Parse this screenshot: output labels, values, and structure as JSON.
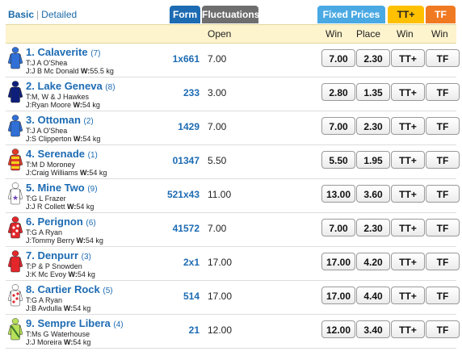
{
  "view_toggle": {
    "basic": "Basic",
    "separator": "|",
    "detailed": "Detailed"
  },
  "tabs": {
    "form": "Form",
    "fluctuations": "Fluctuations",
    "fixed_prices": "Fixed Prices",
    "tt_plus": "TT+",
    "tf": "TF"
  },
  "headers": {
    "open": "Open",
    "win": "Win",
    "place": "Place",
    "tt_win": "Win",
    "tf_win": "Win"
  },
  "colors": {
    "link_blue": "#1d6bb3",
    "header_bg": "#fdf3cc",
    "fixed_prices": "#4aa9e3",
    "tt_plus": "#ffc000",
    "tf": "#f07a22"
  },
  "runners": [
    {
      "name": "1. Calaverite",
      "barrier": "(7)",
      "trainer": "T:J A O'Shea",
      "jockey": "J:J B Mc Donald",
      "weight_label": "W:",
      "weight": "55.5 kg",
      "form": "1x661",
      "open": "7.00",
      "win": "7.00",
      "place": "2.30",
      "tt": "TT+",
      "tf": "TF",
      "silk": "blue"
    },
    {
      "name": "2. Lake Geneva",
      "barrier": "(8)",
      "trainer": "T:M, W & J Hawkes",
      "jockey": "J:Ryan Moore",
      "weight_label": "W:",
      "weight": "54 kg",
      "form": "233",
      "open": "3.00",
      "win": "2.80",
      "place": "1.35",
      "tt": "TT+",
      "tf": "TF",
      "silk": "navy"
    },
    {
      "name": "3. Ottoman",
      "barrier": "(2)",
      "trainer": "T:J A O'Shea",
      "jockey": "J:S Clipperton",
      "weight_label": "W:",
      "weight": "54 kg",
      "form": "1429",
      "open": "7.00",
      "win": "7.00",
      "place": "2.30",
      "tt": "TT+",
      "tf": "TF",
      "silk": "blue"
    },
    {
      "name": "4. Serenade",
      "barrier": "(1)",
      "trainer": "T:M D Moroney",
      "jockey": "J:Craig Williams",
      "weight_label": "W:",
      "weight": "54 kg",
      "form": "01347",
      "open": "5.50",
      "win": "5.50",
      "place": "1.95",
      "tt": "TT+",
      "tf": "TF",
      "silk": "red-yellow"
    },
    {
      "name": "5. Mine Two",
      "barrier": "(9)",
      "trainer": "T:G L Frazer",
      "jockey": "J:J R Collett",
      "weight_label": "W:",
      "weight": "54 kg",
      "form": "521x43",
      "open": "11.00",
      "win": "13.00",
      "place": "3.60",
      "tt": "TT+",
      "tf": "TF",
      "silk": "white-purple"
    },
    {
      "name": "6. Perignon",
      "barrier": "(6)",
      "trainer": "T:G A Ryan",
      "jockey": "J:Tommy Berry",
      "weight_label": "W:",
      "weight": "54 kg",
      "form": "41572",
      "open": "7.00",
      "win": "7.00",
      "place": "2.30",
      "tt": "TT+",
      "tf": "TF",
      "silk": "red-spots"
    },
    {
      "name": "7. Denpurr",
      "barrier": "(3)",
      "trainer": "T:P & P Snowden",
      "jockey": "J:K Mc Evoy",
      "weight_label": "W:",
      "weight": "54 kg",
      "form": "2x1",
      "open": "17.00",
      "win": "17.00",
      "place": "4.20",
      "tt": "TT+",
      "tf": "TF",
      "silk": "red"
    },
    {
      "name": "8. Cartier Rock",
      "barrier": "(5)",
      "trainer": "T:G A Ryan",
      "jockey": "J:B Avdulla",
      "weight_label": "W:",
      "weight": "54 kg",
      "form": "514",
      "open": "17.00",
      "win": "17.00",
      "place": "4.40",
      "tt": "TT+",
      "tf": "TF",
      "silk": "white-redspots"
    },
    {
      "name": "9. Sempre Libera",
      "barrier": "(4)",
      "trainer": "T:Ms G Waterhouse",
      "jockey": "J:J Moreira",
      "weight_label": "W:",
      "weight": "54 kg",
      "form": "21",
      "open": "12.00",
      "win": "12.00",
      "place": "3.40",
      "tt": "TT+",
      "tf": "TF",
      "silk": "lime-white"
    }
  ]
}
